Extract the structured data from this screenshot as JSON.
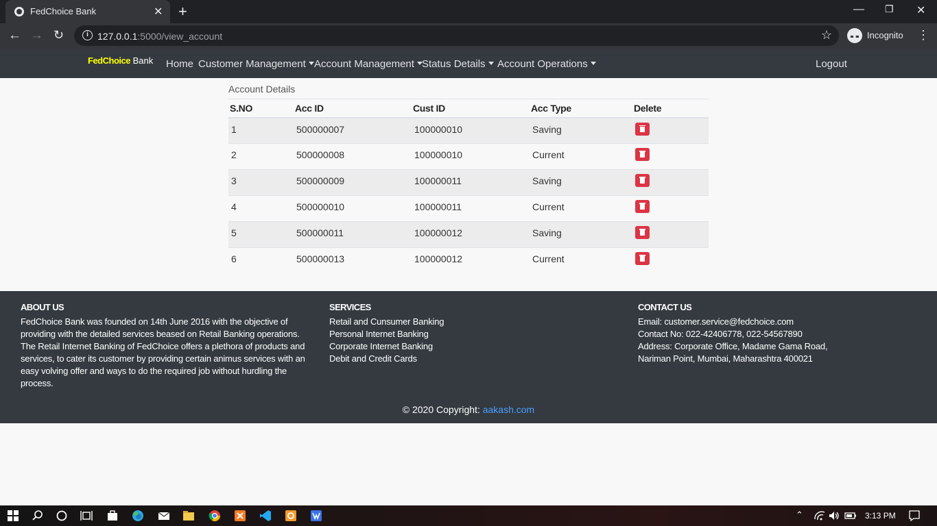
{
  "browser": {
    "tab_title": "FedChoice Bank",
    "new_tab_glyph": "+",
    "close_glyph": "✕",
    "url_host": "127.0.0.1",
    "url_path": ":5000/view_account",
    "profile_label": "Incognito"
  },
  "navbar": {
    "brand_bold": "FedChoice",
    "brand_rest": " Bank",
    "items": [
      {
        "label": "Home"
      },
      {
        "label": "Customer Management"
      },
      {
        "label": "Account Management"
      },
      {
        "label": "Status Details"
      },
      {
        "label": "Account Operations"
      }
    ],
    "logout": "Logout"
  },
  "main": {
    "title": "Account Details",
    "columns": [
      "S.NO",
      "Acc ID",
      "Cust ID",
      "Acc Type",
      "Delete"
    ],
    "rows": [
      {
        "sno": "1",
        "acc_id": "500000007",
        "cust_id": "100000010",
        "type": "Saving"
      },
      {
        "sno": "2",
        "acc_id": "500000008",
        "cust_id": "100000010",
        "type": "Current"
      },
      {
        "sno": "3",
        "acc_id": "500000009",
        "cust_id": "100000011",
        "type": "Saving"
      },
      {
        "sno": "4",
        "acc_id": "500000010",
        "cust_id": "100000011",
        "type": "Current"
      },
      {
        "sno": "5",
        "acc_id": "500000011",
        "cust_id": "100000012",
        "type": "Saving"
      },
      {
        "sno": "6",
        "acc_id": "500000013",
        "cust_id": "100000012",
        "type": "Current"
      }
    ]
  },
  "footer": {
    "about_head": "ABOUT US",
    "about_text": "FedChoice Bank was founded on 14th June 2016 with the objective of providing with the detailed services beased on Retail Banking operations. The Retail Internet Banking of FedChoice offers a plethora of products and services, to cater its customer by providing certain animus services with an easy volving offer and ways to do the required job without hurdling the process.",
    "services_head": "SERVICES",
    "services": [
      "Retail and Cunsumer Banking",
      "Personal Internet Banking",
      "Corporate Internet Banking",
      "Debit and Credit Cards"
    ],
    "contact_head": "CONTACT US",
    "contact": [
      "Email: customer.service@fedchoice.com",
      "Contact No: 022-42406778, 022-54567890",
      "Address: Corporate Office, Madame Gama Road,",
      "Nariman Point, Mumbai, Maharashtra 400021"
    ],
    "copyright_text": "© 2020 Copyright: ",
    "copyright_link": "aakash.com"
  },
  "taskbar": {
    "clock": "3:13 PM"
  },
  "colors": {
    "navbar_bg": "#343a40",
    "brand_accent": "#ffff00",
    "delete_red": "#dc3545",
    "link_blue": "#4a9eff"
  }
}
